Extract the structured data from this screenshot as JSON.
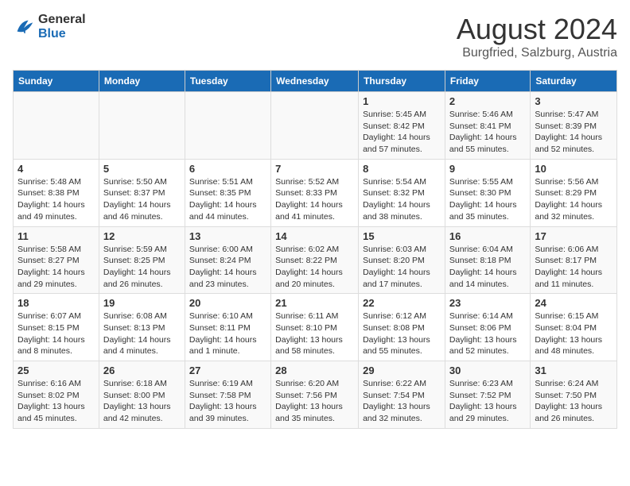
{
  "header": {
    "logo_line1": "General",
    "logo_line2": "Blue",
    "month": "August 2024",
    "location": "Burgfried, Salzburg, Austria"
  },
  "weekdays": [
    "Sunday",
    "Monday",
    "Tuesday",
    "Wednesday",
    "Thursday",
    "Friday",
    "Saturday"
  ],
  "weeks": [
    [
      {
        "day": "",
        "info": ""
      },
      {
        "day": "",
        "info": ""
      },
      {
        "day": "",
        "info": ""
      },
      {
        "day": "",
        "info": ""
      },
      {
        "day": "1",
        "info": "Sunrise: 5:45 AM\nSunset: 8:42 PM\nDaylight: 14 hours\nand 57 minutes."
      },
      {
        "day": "2",
        "info": "Sunrise: 5:46 AM\nSunset: 8:41 PM\nDaylight: 14 hours\nand 55 minutes."
      },
      {
        "day": "3",
        "info": "Sunrise: 5:47 AM\nSunset: 8:39 PM\nDaylight: 14 hours\nand 52 minutes."
      }
    ],
    [
      {
        "day": "4",
        "info": "Sunrise: 5:48 AM\nSunset: 8:38 PM\nDaylight: 14 hours\nand 49 minutes."
      },
      {
        "day": "5",
        "info": "Sunrise: 5:50 AM\nSunset: 8:37 PM\nDaylight: 14 hours\nand 46 minutes."
      },
      {
        "day": "6",
        "info": "Sunrise: 5:51 AM\nSunset: 8:35 PM\nDaylight: 14 hours\nand 44 minutes."
      },
      {
        "day": "7",
        "info": "Sunrise: 5:52 AM\nSunset: 8:33 PM\nDaylight: 14 hours\nand 41 minutes."
      },
      {
        "day": "8",
        "info": "Sunrise: 5:54 AM\nSunset: 8:32 PM\nDaylight: 14 hours\nand 38 minutes."
      },
      {
        "day": "9",
        "info": "Sunrise: 5:55 AM\nSunset: 8:30 PM\nDaylight: 14 hours\nand 35 minutes."
      },
      {
        "day": "10",
        "info": "Sunrise: 5:56 AM\nSunset: 8:29 PM\nDaylight: 14 hours\nand 32 minutes."
      }
    ],
    [
      {
        "day": "11",
        "info": "Sunrise: 5:58 AM\nSunset: 8:27 PM\nDaylight: 14 hours\nand 29 minutes."
      },
      {
        "day": "12",
        "info": "Sunrise: 5:59 AM\nSunset: 8:25 PM\nDaylight: 14 hours\nand 26 minutes."
      },
      {
        "day": "13",
        "info": "Sunrise: 6:00 AM\nSunset: 8:24 PM\nDaylight: 14 hours\nand 23 minutes."
      },
      {
        "day": "14",
        "info": "Sunrise: 6:02 AM\nSunset: 8:22 PM\nDaylight: 14 hours\nand 20 minutes."
      },
      {
        "day": "15",
        "info": "Sunrise: 6:03 AM\nSunset: 8:20 PM\nDaylight: 14 hours\nand 17 minutes."
      },
      {
        "day": "16",
        "info": "Sunrise: 6:04 AM\nSunset: 8:18 PM\nDaylight: 14 hours\nand 14 minutes."
      },
      {
        "day": "17",
        "info": "Sunrise: 6:06 AM\nSunset: 8:17 PM\nDaylight: 14 hours\nand 11 minutes."
      }
    ],
    [
      {
        "day": "18",
        "info": "Sunrise: 6:07 AM\nSunset: 8:15 PM\nDaylight: 14 hours\nand 8 minutes."
      },
      {
        "day": "19",
        "info": "Sunrise: 6:08 AM\nSunset: 8:13 PM\nDaylight: 14 hours\nand 4 minutes."
      },
      {
        "day": "20",
        "info": "Sunrise: 6:10 AM\nSunset: 8:11 PM\nDaylight: 14 hours\nand 1 minute."
      },
      {
        "day": "21",
        "info": "Sunrise: 6:11 AM\nSunset: 8:10 PM\nDaylight: 13 hours\nand 58 minutes."
      },
      {
        "day": "22",
        "info": "Sunrise: 6:12 AM\nSunset: 8:08 PM\nDaylight: 13 hours\nand 55 minutes."
      },
      {
        "day": "23",
        "info": "Sunrise: 6:14 AM\nSunset: 8:06 PM\nDaylight: 13 hours\nand 52 minutes."
      },
      {
        "day": "24",
        "info": "Sunrise: 6:15 AM\nSunset: 8:04 PM\nDaylight: 13 hours\nand 48 minutes."
      }
    ],
    [
      {
        "day": "25",
        "info": "Sunrise: 6:16 AM\nSunset: 8:02 PM\nDaylight: 13 hours\nand 45 minutes."
      },
      {
        "day": "26",
        "info": "Sunrise: 6:18 AM\nSunset: 8:00 PM\nDaylight: 13 hours\nand 42 minutes."
      },
      {
        "day": "27",
        "info": "Sunrise: 6:19 AM\nSunset: 7:58 PM\nDaylight: 13 hours\nand 39 minutes."
      },
      {
        "day": "28",
        "info": "Sunrise: 6:20 AM\nSunset: 7:56 PM\nDaylight: 13 hours\nand 35 minutes."
      },
      {
        "day": "29",
        "info": "Sunrise: 6:22 AM\nSunset: 7:54 PM\nDaylight: 13 hours\nand 32 minutes."
      },
      {
        "day": "30",
        "info": "Sunrise: 6:23 AM\nSunset: 7:52 PM\nDaylight: 13 hours\nand 29 minutes."
      },
      {
        "day": "31",
        "info": "Sunrise: 6:24 AM\nSunset: 7:50 PM\nDaylight: 13 hours\nand 26 minutes."
      }
    ]
  ]
}
